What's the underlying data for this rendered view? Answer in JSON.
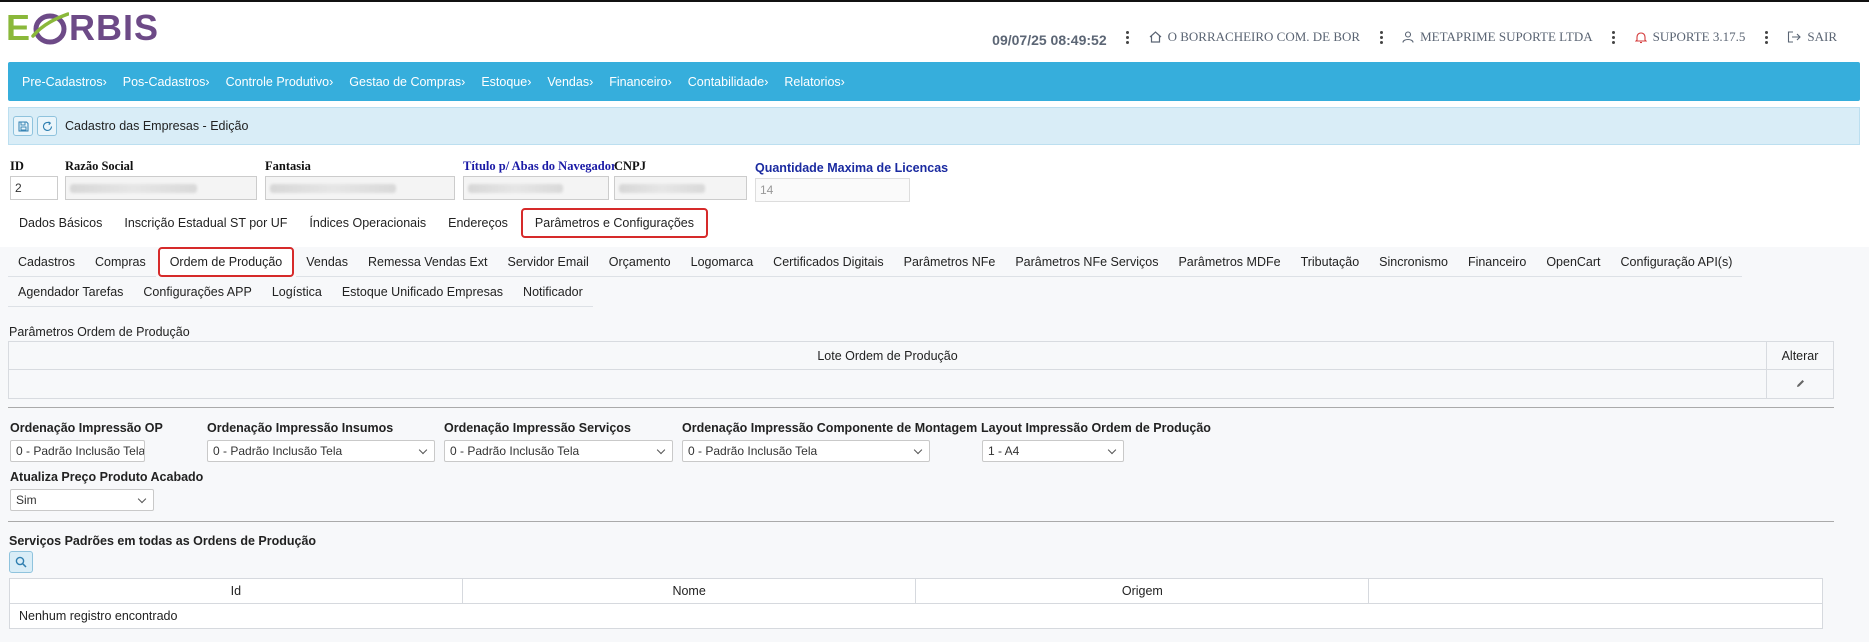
{
  "logo": {
    "letter_e": "E",
    "letters_rest": "RBIS"
  },
  "header": {
    "datetime": "09/07/25 08:49:52",
    "company": "O BORRACHEIRO COM. DE BOR",
    "user": "METAPRIME SUPORTE LTDA",
    "version": "SUPORTE 3.17.5",
    "logout": "SAIR"
  },
  "menu": [
    "Pre-Cadastros›",
    "Pos-Cadastros›",
    "Controle Produtivo›",
    "Gestao de Compras›",
    "Estoque›",
    "Vendas›",
    "Financeiro›",
    "Contabilidade›",
    "Relatorios›"
  ],
  "toolbar": {
    "title": "Cadastro das Empresas - Edição"
  },
  "fields": {
    "id_label": "ID",
    "id_value": "2",
    "razao_label": "Razão Social",
    "fantasia_label": "Fantasia",
    "titulo_label": "Título p/ Abas do Navegador",
    "cnpj_label": "CNPJ",
    "licencas_label": "Quantidade Maxima de Licencas",
    "licencas_value": "14"
  },
  "main_tabs": [
    "Dados Básicos",
    "Inscrição Estadual ST por UF",
    "Índices Operacionais",
    "Endereços",
    "Parâmetros e Configurações"
  ],
  "sub_tabs_row1": [
    "Cadastros",
    "Compras",
    "Ordem de Produção",
    "Vendas",
    "Remessa Vendas Ext",
    "Servidor Email",
    "Orçamento",
    "Logomarca",
    "Certificados Digitais",
    "Parâmetros NFe",
    "Parâmetros NFe Serviços",
    "Parâmetros MDFe",
    "Tributação",
    "Sincronismo",
    "Financeiro",
    "OpenCart",
    "Configuração API(s)"
  ],
  "sub_tabs_row2": [
    "Agendador Tarefas",
    "Configurações APP",
    "Logística",
    "Estoque Unificado Empresas",
    "Notificador"
  ],
  "ordem": {
    "section_title": "Parâmetros Ordem de Produção",
    "lote_header": "Lote Ordem de Produção",
    "alterar_header": "Alterar",
    "params": {
      "op_label": "Ordenação Impressão OP",
      "op_value": "0 - Padrão Inclusão Tela",
      "insumos_label": "Ordenação Impressão Insumos",
      "insumos_value": "0 - Padrão Inclusão Tela",
      "servicos_label": "Ordenação Impressão Serviços",
      "servicos_value": "0 - Padrão Inclusão Tela",
      "componente_label": "Ordenação Impressão Componente de Montagem",
      "componente_value": "0 - Padrão Inclusão Tela",
      "layout_label": "Layout Impressão Ordem de Produção",
      "layout_value": "1 - A4",
      "atualiza_label": "Atualiza Preço Produto Acabado",
      "atualiza_value": "Sim"
    },
    "servicos_title": "Serviços Padrões em todas as Ordens de Produção",
    "servicos_columns": [
      "Id",
      "Nome",
      "Origem",
      ""
    ],
    "servicos_empty": "Nenhum registro encontrado"
  },
  "colors": {
    "menu_bg": "#36aedc",
    "toolbar_bg": "#d9edf7",
    "active_outline": "#d62a2a",
    "logo_green": "#8ab83a",
    "logo_purple": "#6d4a87"
  }
}
